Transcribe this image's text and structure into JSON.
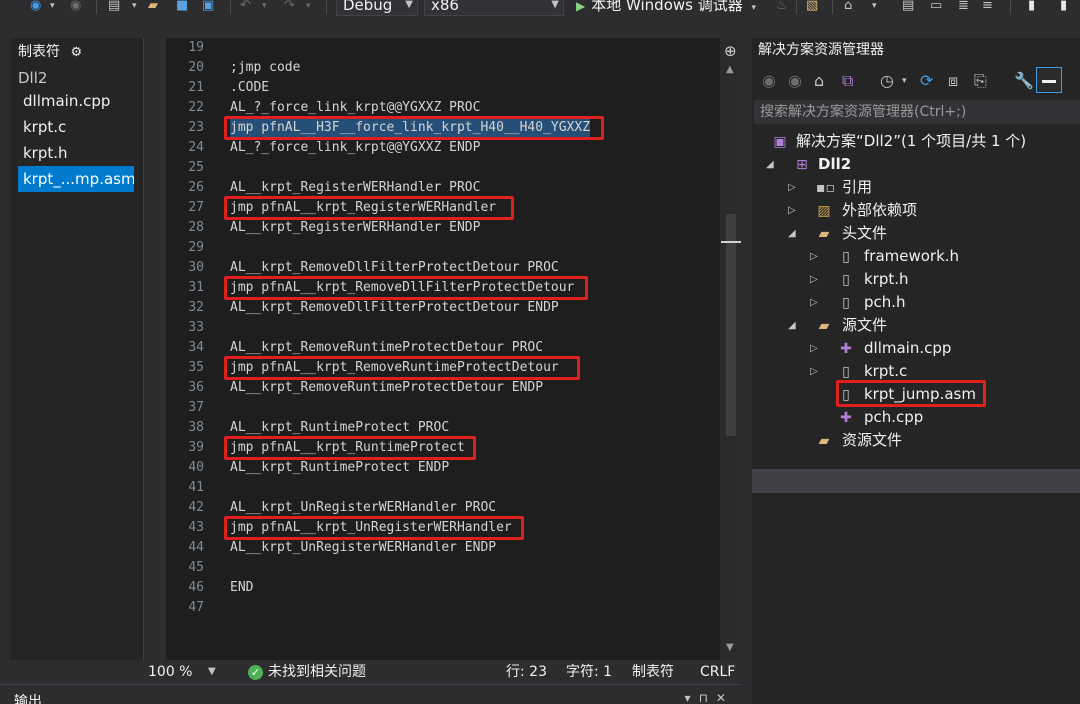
{
  "toolbar": {
    "config": "Debug",
    "platform": "x86",
    "run_label": "本地 Windows 调试器"
  },
  "left_panel": {
    "title": "制表符",
    "project": "Dll2",
    "files": [
      "dllmain.cpp",
      "krpt.c",
      "krpt.h",
      "krpt_...mp.asm"
    ]
  },
  "editor": {
    "lines": [
      {
        "n": "19",
        "text": ""
      },
      {
        "n": "20",
        "text": ";jmp code"
      },
      {
        "n": "21",
        "text": ".CODE"
      },
      {
        "n": "22",
        "text": "AL_?_force_link_krpt@@YGXXZ PROC"
      },
      {
        "n": "23",
        "text": "jmp pfnAL__H3F__force_link_krpt_H40__H40_YGXXZ"
      },
      {
        "n": "24",
        "text": "AL_?_force_link_krpt@@YGXXZ ENDP"
      },
      {
        "n": "25",
        "text": ""
      },
      {
        "n": "26",
        "text": "AL__krpt_RegisterWERHandler PROC"
      },
      {
        "n": "27",
        "text": "jmp pfnAL__krpt_RegisterWERHandler"
      },
      {
        "n": "28",
        "text": "AL__krpt_RegisterWERHandler ENDP"
      },
      {
        "n": "29",
        "text": ""
      },
      {
        "n": "30",
        "text": "AL__krpt_RemoveDllFilterProtectDetour PROC"
      },
      {
        "n": "31",
        "text": "jmp pfnAL__krpt_RemoveDllFilterProtectDetour"
      },
      {
        "n": "32",
        "text": "AL__krpt_RemoveDllFilterProtectDetour ENDP"
      },
      {
        "n": "33",
        "text": ""
      },
      {
        "n": "34",
        "text": "AL__krpt_RemoveRuntimeProtectDetour PROC"
      },
      {
        "n": "35",
        "text": "jmp pfnAL__krpt_RemoveRuntimeProtectDetour"
      },
      {
        "n": "36",
        "text": "AL__krpt_RemoveRuntimeProtectDetour ENDP"
      },
      {
        "n": "37",
        "text": ""
      },
      {
        "n": "38",
        "text": "AL__krpt_RuntimeProtect PROC"
      },
      {
        "n": "39",
        "text": "jmp pfnAL__krpt_RuntimeProtect"
      },
      {
        "n": "40",
        "text": "AL__krpt_RuntimeProtect ENDP"
      },
      {
        "n": "41",
        "text": ""
      },
      {
        "n": "42",
        "text": "AL__krpt_UnRegisterWERHandler PROC"
      },
      {
        "n": "43",
        "text": "jmp pfnAL__krpt_UnRegisterWERHandler"
      },
      {
        "n": "44",
        "text": "AL__krpt_UnRegisterWERHandler ENDP"
      },
      {
        "n": "45",
        "text": ""
      },
      {
        "n": "46",
        "text": "END"
      },
      {
        "n": "47",
        "text": ""
      }
    ]
  },
  "status": {
    "zoom": "100 %",
    "issues": "未找到相关问题",
    "line": "行: 23",
    "char": "字符: 1",
    "tab_mode": "制表符",
    "eol": "CRLF"
  },
  "bottom": {
    "title": "输出"
  },
  "solution": {
    "title": "解决方案资源管理器",
    "search_placeholder": "搜索解决方案资源管理器(Ctrl+;)",
    "solution_label": "解决方案“Dll2”(1 个项目/共 1 个)",
    "project": "Dll2",
    "references": "引用",
    "external_deps": "外部依赖项",
    "headers": "头文件",
    "header_files": [
      "framework.h",
      "krpt.h",
      "pch.h"
    ],
    "sources": "源文件",
    "source_files": [
      "dllmain.cpp",
      "krpt.c",
      "krpt_jump.asm",
      "pch.cpp"
    ],
    "resources": "资源文件"
  },
  "colors": {
    "highlight_box": "#e0201e",
    "selection": "#264f78",
    "accent": "#007acc"
  }
}
